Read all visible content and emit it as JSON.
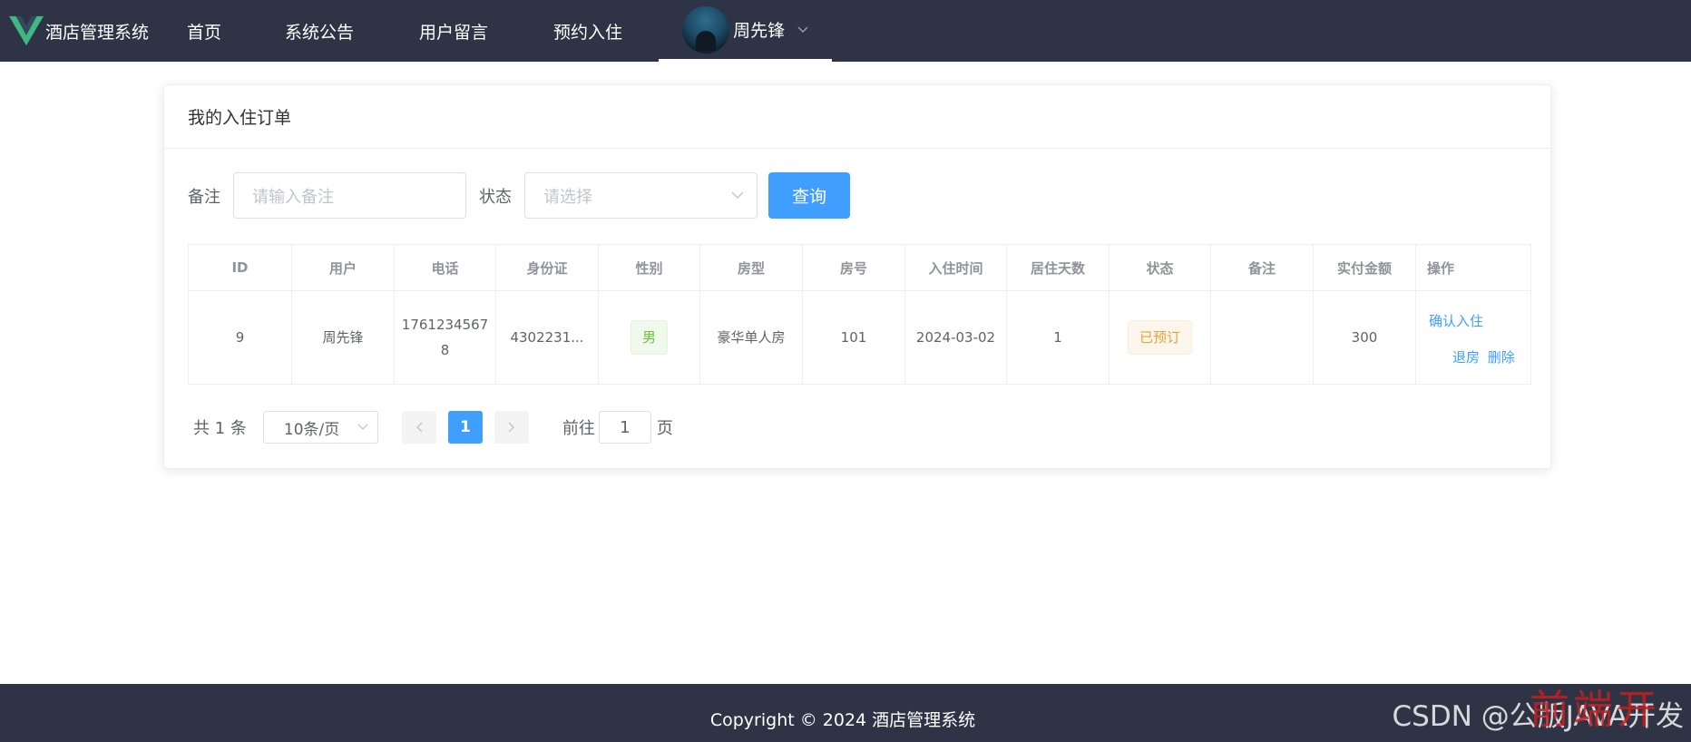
{
  "app": {
    "brand_name": "酒店管理系统",
    "brand_logo": "vue-logo-icon",
    "colors": {
      "navbar_bg": "#2e3445",
      "primary": "#409eff",
      "tag_success": "#67c23a",
      "tag_warning": "#e6a23c"
    }
  },
  "nav": {
    "items": [
      {
        "label": "首页"
      },
      {
        "label": "系统公告"
      },
      {
        "label": "用户留言"
      },
      {
        "label": "预约入住"
      }
    ],
    "user": {
      "name": "周先锋",
      "dropdown_icon": "chevron-down-icon"
    }
  },
  "card": {
    "title": "我的入住订单"
  },
  "search": {
    "note_label": "备注",
    "note_placeholder": "请输入备注",
    "status_label": "状态",
    "status_placeholder": "请选择",
    "query_button": "查询"
  },
  "table": {
    "columns": [
      "ID",
      "用户",
      "电话",
      "身份证",
      "性别",
      "房型",
      "房号",
      "入住时间",
      "居住天数",
      "状态",
      "备注",
      "实付金额",
      "操作"
    ],
    "rows": [
      {
        "id": "9",
        "user": "周先锋",
        "phone": "17612345678",
        "id_card": "4302231...",
        "gender": "男",
        "room_type": "豪华单人房",
        "room_no": "101",
        "checkin_date": "2024-03-02",
        "days": "1",
        "status": "已预订",
        "note": "",
        "amount": "300",
        "actions": {
          "confirm": "确认入住",
          "checkout": "退房",
          "delete": "删除"
        }
      }
    ]
  },
  "pagination": {
    "total_text": "共 1 条",
    "page_size": "10条/页",
    "current_page": "1",
    "goto_label": "前往",
    "goto_value": "1",
    "page_suffix": "页"
  },
  "footer": {
    "copyright": "Copyright © 2024 酒店管理系统"
  },
  "watermark": {
    "text": "CSDN @公版JAVA开发",
    "overlay": "前端开"
  }
}
